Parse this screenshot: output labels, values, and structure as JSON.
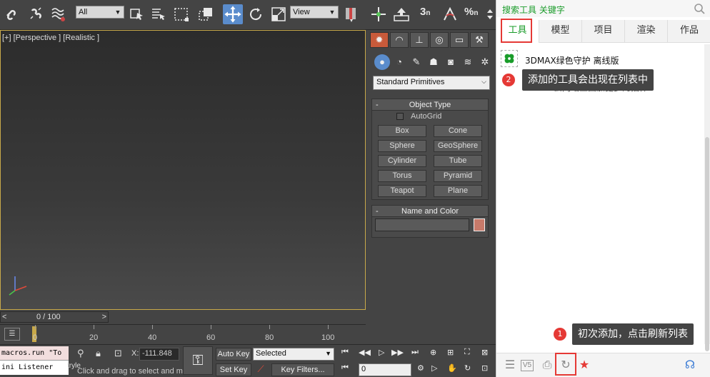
{
  "max": {
    "toolbar": {
      "filter_select": "All",
      "refcoord_select": "View",
      "snap_label": "3",
      "percent_label": "%",
      "snap_suffix": "n"
    },
    "viewport": {
      "label": "[+] [Perspective ] [Realistic ]"
    },
    "command_panel": {
      "category_select": "Standard Primitives",
      "object_type": {
        "title": "Object Type",
        "autogrid": "AutoGrid",
        "buttons": [
          "Box",
          "Cone",
          "Sphere",
          "GeoSphere",
          "Cylinder",
          "Tube",
          "Torus",
          "Pyramid",
          "Teapot",
          "Plane"
        ]
      },
      "name_color": {
        "title": "Name and Color"
      },
      "colors": {
        "swatch": "#c87a6a",
        "active_tab": "#c85a3a",
        "active_tool": "#5a8ccc"
      }
    },
    "time_slider": {
      "label": "0 / 100",
      "left": "<",
      "right": ">"
    },
    "track": {
      "labels": [
        "0",
        "20",
        "40",
        "60",
        "80",
        "100"
      ]
    },
    "status": {
      "script_line1": "macros.run \"To",
      "script_line2": "ini Listener",
      "style_text": "tryle",
      "x_label": "X:",
      "x_value": "-111.848",
      "hint": "Click and drag to select and mo",
      "autokey": "Auto Key",
      "setkey": "Set Key",
      "selected": "Selected",
      "key_filters": "Key Filters...",
      "frame": "0"
    }
  },
  "plugin": {
    "search_label": "搜索工具  关键字",
    "tabs": [
      "工具",
      "模型",
      "项目",
      "渲染",
      "作品"
    ],
    "active_tab": "工具",
    "item": {
      "name": "3DMAX绿色守护  离线版"
    },
    "ghost_text": "去网站上面加更多的插件",
    "tip2": {
      "badge": "2",
      "text": "添加的工具会出现在列表中"
    },
    "tip1": {
      "badge": "1",
      "text": "初次添加，点击刷新列表"
    },
    "colors": {
      "accent": "#1a9c2a",
      "highlight": "#e53935",
      "tip_bg": "#444444"
    }
  }
}
